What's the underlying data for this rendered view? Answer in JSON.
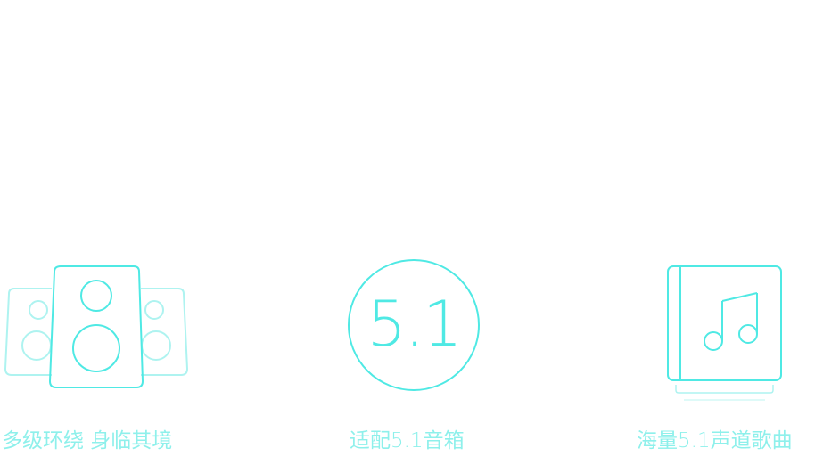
{
  "colors": {
    "accent": "#4fe9e4",
    "accent_light": "#aef3f0",
    "background": "#ffffff"
  },
  "features": [
    {
      "icon": "speaker-icon",
      "label": "多级环绕 身临其境"
    },
    {
      "icon": "five-point-one-badge-icon",
      "badge_text": "5.1",
      "label": "适配5.1音箱"
    },
    {
      "icon": "music-album-icon",
      "label": "海量5.1声道歌曲"
    }
  ]
}
